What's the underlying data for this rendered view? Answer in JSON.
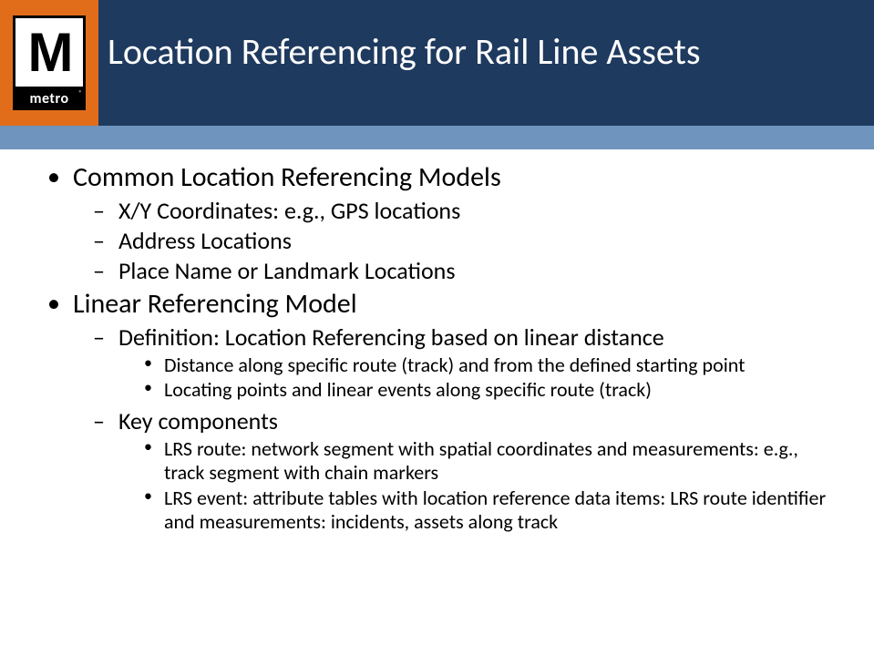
{
  "logo": {
    "letter": "M",
    "word": "metro",
    "registered": "®"
  },
  "title": "Location Referencing for Rail Line Assets",
  "bullets": [
    {
      "text": "Common Location Referencing Models",
      "children": [
        {
          "text": "X/Y Coordinates: e.g., GPS locations"
        },
        {
          "text": "Address Locations"
        },
        {
          "text": "Place Name or Landmark Locations"
        }
      ]
    },
    {
      "text": "Linear Referencing Model",
      "children": [
        {
          "text": "Definition: Location Referencing based on linear distance",
          "children": [
            {
              "text": "Distance along specific route (track) and from the defined starting point"
            },
            {
              "text": "Locating points and linear events along specific route (track)"
            }
          ]
        },
        {
          "text": "Key components",
          "children": [
            {
              "text": "LRS route: network segment with spatial coordinates and measurements: e.g., track segment with chain markers"
            },
            {
              "text": "LRS event: attribute tables with location reference data items: LRS route identifier and measurements: incidents, assets along track"
            }
          ]
        }
      ]
    }
  ]
}
